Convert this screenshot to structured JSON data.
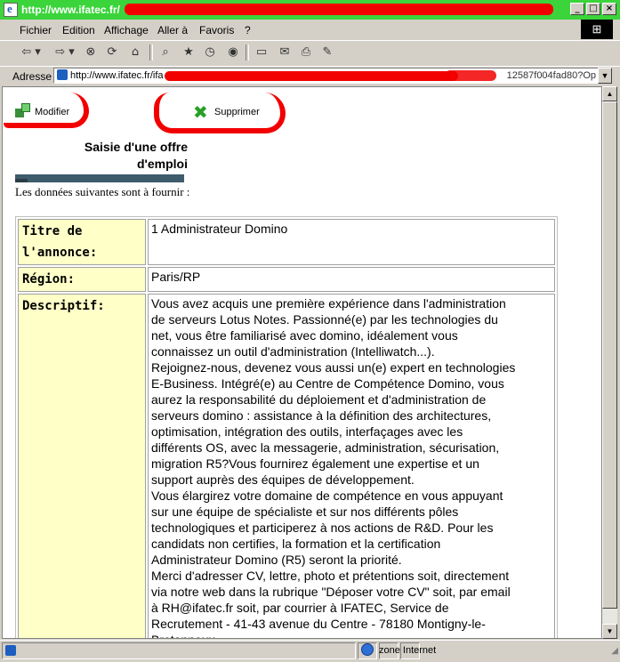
{
  "window": {
    "title": "http://www.ifatec.fr/",
    "buttons": [
      "_",
      "□",
      "×"
    ]
  },
  "menu": {
    "items": [
      "Fichier",
      "Edition",
      "Affichage",
      "Aller à",
      "Favoris",
      "?"
    ]
  },
  "toolbar": {
    "icons": [
      "back-icon",
      "forward-icon",
      "stop-icon",
      "refresh-icon",
      "home-icon",
      "search-icon",
      "favorites-icon",
      "history-icon",
      "mail-icon",
      "print-icon",
      "edit-icon"
    ]
  },
  "address": {
    "label": "Adresse",
    "url_start": "http://www.ifatec.fr/ifa",
    "url_end": "12587f004fad80?Op"
  },
  "actions": {
    "modify": "Modifier",
    "delete": "Supprimer"
  },
  "page": {
    "title_line1": "Saisie d'une offre",
    "title_line2": "d'emploi",
    "intro": "Les données suivantes sont à fournir :"
  },
  "form": {
    "title_label_1": "Titre de",
    "title_label_2": "l'annonce:",
    "title_value": "1 Administrateur Domino",
    "region_label": "Région:",
    "region_value": "Paris/RP",
    "desc_label": "Descriptif:",
    "desc_lines": [
      "Vous avez acquis une première expérience dans l'administration",
      "de serveurs Lotus Notes. Passionné(e) par les technologies du",
      "net, vous être familiarisé avec domino, idéalement vous",
      "connaissez un outil d'administration (Intelliwatch...).",
      "Rejoignez-nous, devenez vous aussi un(e) expert en technologies",
      "E-Business. Intégré(e) au Centre de Compétence Domino, vous",
      "aurez la responsabilité du déploiement et d'administration de",
      "serveurs domino : assistance à la définition des architectures,",
      "optimisation, intégration des outils, interfaçages avec les",
      "différents OS, avec la messagerie, administration, sécurisation,",
      "migration R5?Vous fournirez également une expertise et un",
      "support auprès des équipes de développement.",
      "Vous élargirez votre domaine de compétence en vous appuyant",
      "sur une équipe de spécialiste et sur nos différents pôles",
      "technologiques et participerez à nos actions de R&D. Pour les",
      "candidats non certifies, la formation et la certification",
      "Administrateur Domino (R5) seront la priorité.",
      "Merci d'adresser CV, lettre, photo et prétentions soit, directement",
      "via notre web dans la rubrique \"Déposer votre CV\" soit, par email",
      "à RH@ifatec.fr soit, par courrier à IFATEC, Service de",
      "Recrutement - 41-43 avenue du Centre - 78180 Montigny-le-",
      "Bretonneux."
    ]
  },
  "status": {
    "zone": "zone Internet"
  },
  "colors": {
    "titlebar": "#3bd43b",
    "redaction": "#f20000",
    "label_bg": "#ffffc8"
  }
}
